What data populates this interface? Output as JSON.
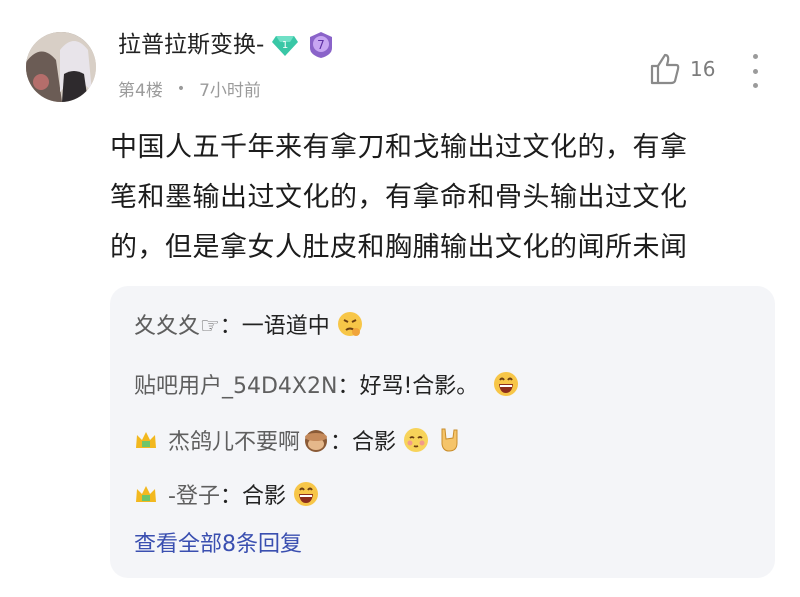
{
  "post": {
    "username": "拉普拉斯变换-",
    "gem_badge": "1",
    "level_badge": "7",
    "floor": "第4楼",
    "separator": "•",
    "time": "7小时前",
    "like_count": "16",
    "content_lines": [
      "中国人五千年来有拿刀和戈输出过文化的，有拿",
      "笔和墨输出过文化的，有拿命和骨头输出过文化",
      "的，但是拿女人肚皮和胸脯输出文化的闻所未闻"
    ]
  },
  "replies": [
    {
      "name": "夊夊夊☞",
      "sep": "：",
      "text": "一语道中",
      "icons": [
        "thinking-emoji-icon"
      ]
    },
    {
      "name": "贴吧用户_54D4X2N",
      "sep": "：",
      "text": "好骂!合影。",
      "icons": [
        "grin-emoji-icon"
      ]
    },
    {
      "name": "杰鸽儿不要啊",
      "sep": "：",
      "text": "合影",
      "icons": [
        "crown-icon",
        "monkey-emoji-icon",
        "blush-emoji-icon",
        "rock-hand-icon"
      ]
    },
    {
      "name": "-登子",
      "sep": "：",
      "text": "合影",
      "icons": [
        "crown-icon",
        "grin-emoji-icon"
      ]
    }
  ],
  "view_all": "查看全部8条回复",
  "colors": {
    "link": "#3a4fb0",
    "reply_bg": "#f4f5f8",
    "meta": "#9b9b9b"
  }
}
